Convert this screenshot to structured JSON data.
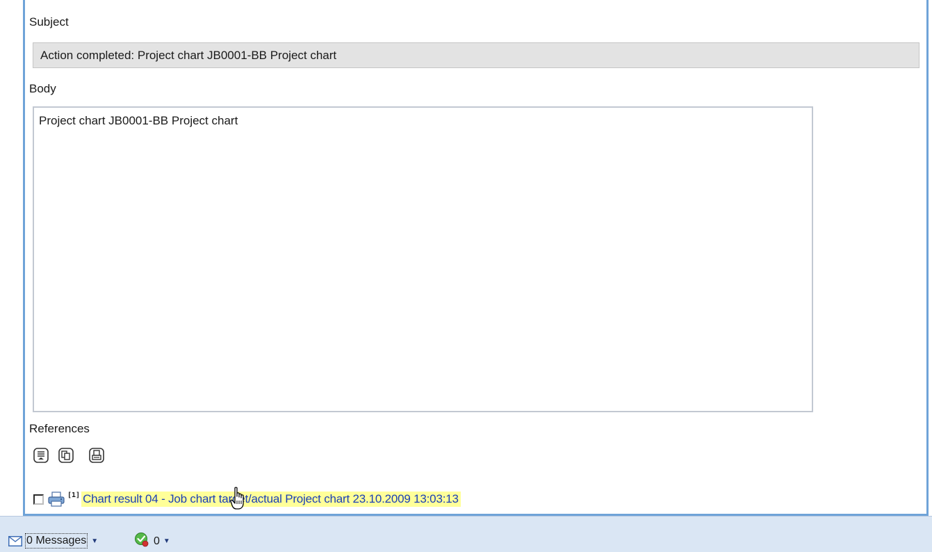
{
  "form": {
    "subject_label": "Subject",
    "subject_value": "Action completed: Project chart JB0001-BB Project chart",
    "body_label": "Body",
    "body_value": "Project chart JB0001-BB Project chart",
    "references_label": "References"
  },
  "references": {
    "toolbar_icons": [
      "list-view-icon",
      "copy-icon",
      "print-preview-icon"
    ],
    "items": [
      {
        "index": "[1]",
        "icon": "printer-icon",
        "link_text": "Chart result 04 - Job chart target/actual Project chart 23.10.2009 13:03:13",
        "checked": false
      }
    ]
  },
  "statusbar": {
    "messages_label": "0 Messages",
    "check_count": "0"
  },
  "colors": {
    "panel_border": "#6fa3d8",
    "link": "#1a3fb5",
    "link_highlight": "#ffff99",
    "statusbar_bg": "#dae6f4"
  }
}
